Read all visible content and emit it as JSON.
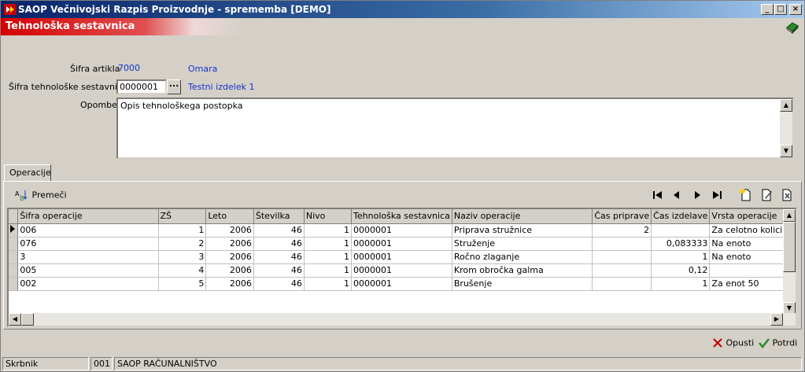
{
  "window": {
    "title": "SAOP   Večnivojski Razpis Proizvodnje - sprememba [DEMO]",
    "minimize": "_",
    "maximize": "□",
    "close": "×"
  },
  "header": {
    "title": "Tehnološka sestavnica"
  },
  "form": {
    "sifra_artikla_label": "Šifra artikla",
    "sifra_artikla_value": "7000",
    "artikel_name": "Omara",
    "sestavnica_label": "Šifra tehnološke sestavnice",
    "sestavnica_value": "0000001",
    "browse_label": "...",
    "sestavnica_name": "Testni izdelek 1",
    "opombe_label": "Opombe",
    "opombe_value": "Opis tehnološkega postopka"
  },
  "tabs": [
    {
      "label": "Operacije"
    }
  ],
  "toolbar": {
    "premeci_label": "Premeči"
  },
  "grid": {
    "columns": [
      "Šifra operacije",
      "ZŠ",
      "Leto",
      "Številka",
      "Nivo",
      "Tehnološka sestavnica",
      "Naziv operacije",
      "Čas priprave",
      "Čas izdelave",
      "Vrsta operacije"
    ],
    "rows": [
      [
        "006",
        "1",
        "2006",
        "46",
        "1",
        "0000001",
        "Priprava stružnice",
        "2",
        "",
        "Za celotno kolicino"
      ],
      [
        "076",
        "2",
        "2006",
        "46",
        "1",
        "0000001",
        "Struženje",
        "",
        "0,083333",
        "Na enoto"
      ],
      [
        "3",
        "3",
        "2006",
        "46",
        "1",
        "0000001",
        "Ročno zlaganje",
        "",
        "1",
        "Na enoto"
      ],
      [
        "005",
        "4",
        "2006",
        "46",
        "1",
        "0000001",
        "Krom obročka galma",
        "",
        "0,12",
        ""
      ],
      [
        "002",
        "5",
        "2006",
        "46",
        "1",
        "0000001",
        "Brušenje",
        "",
        "1",
        "Za enot 50"
      ]
    ]
  },
  "actions": {
    "cancel_label": "Opusti",
    "confirm_label": "Potrdi"
  },
  "status": {
    "user": "Skrbnik",
    "company_code": "001",
    "company_name": "SAOP RAČUNALNIŠTVO"
  }
}
